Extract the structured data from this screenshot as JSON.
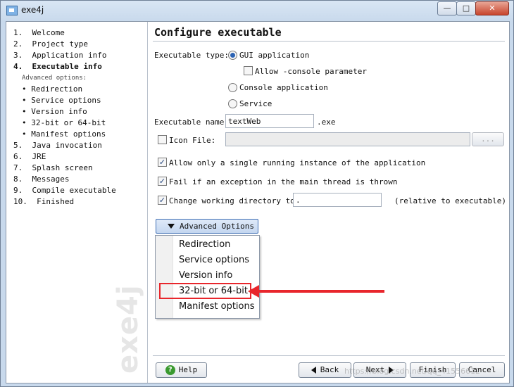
{
  "window": {
    "title": "exe4j",
    "min_label": "—",
    "max_label": "□",
    "close_label": "✕"
  },
  "sidebar": {
    "steps": [
      {
        "text": "1.  Welcome"
      },
      {
        "text": "2.  Project type"
      },
      {
        "text": "3.  Application info"
      },
      {
        "text": "4.  Executable info"
      },
      {
        "text": "Advanced options:"
      },
      {
        "text": "• Redirection"
      },
      {
        "text": "• Service options"
      },
      {
        "text": "• Version info"
      },
      {
        "text": "• 32-bit or 64-bit"
      },
      {
        "text": "• Manifest options"
      },
      {
        "text": "5.  Java invocation"
      },
      {
        "text": "6.  JRE"
      },
      {
        "text": "7.  Splash screen"
      },
      {
        "text": "8.  Messages"
      },
      {
        "text": "9.  Compile executable"
      },
      {
        "text": "10.  Finished"
      }
    ],
    "watermark": "exe4j"
  },
  "page": {
    "title": "Configure executable"
  },
  "form": {
    "exe_type_label": "Executable type:",
    "gui_label": "GUI application",
    "allow_console_label": "Allow -console parameter",
    "console_label": "Console application",
    "service_label": "Service",
    "exe_name_label": "Executable name:",
    "exe_name_value": "textWeb",
    "exe_suffix": ".exe",
    "icon_file_label": "Icon File:",
    "icon_browse_label": "...",
    "single_instance_label": "Allow only a single running instance of the application",
    "fail_exception_label": "Fail if an exception in the main thread is thrown",
    "change_dir_label": "Change working directory to:",
    "change_dir_value": ".",
    "relative_label": "(relative to executable)",
    "check_mark": "✓"
  },
  "advanced": {
    "button_label": "Advanced Options",
    "menu_items": [
      "Redirection",
      "Service options",
      "Version info",
      "32-bit or 64-bit",
      "Manifest options"
    ]
  },
  "footer": {
    "help_label": "Help",
    "help_icon": "?",
    "back_label": "Back",
    "next_label": "Next",
    "finish_label": "Finish",
    "cancel_label": "Cancel"
  },
  "overlay_watermark": "https://blog.csdn.net/qq_41556612",
  "colors": {
    "annotation_red": "#e8262c",
    "selection_blue": "#2b62b3"
  }
}
